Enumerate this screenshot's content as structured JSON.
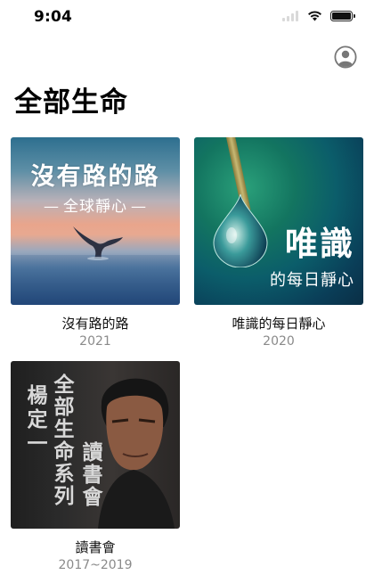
{
  "status_bar": {
    "time": "9:04",
    "icons": [
      "cellular-signal-icon",
      "wifi-icon",
      "battery-icon"
    ]
  },
  "header": {
    "title": "全部生命",
    "profile_icon": "person-circle-icon"
  },
  "colors": {
    "accent": "#8a8a8a",
    "title": "#000000",
    "subtitle": "#8a8a8a"
  },
  "books": [
    {
      "title": "沒有路的路",
      "year": "2021",
      "cover": {
        "line1": "沒有路的路",
        "line2": "全球靜心"
      }
    },
    {
      "title": "唯識的每日靜心",
      "year": "2020",
      "cover": {
        "line1": "唯識",
        "line2": "的每日靜心"
      }
    },
    {
      "title": "讀書會",
      "year": "2017~2019",
      "cover": {
        "author": "楊定一",
        "series": "全部生命系列",
        "club": "讀書會"
      }
    }
  ]
}
